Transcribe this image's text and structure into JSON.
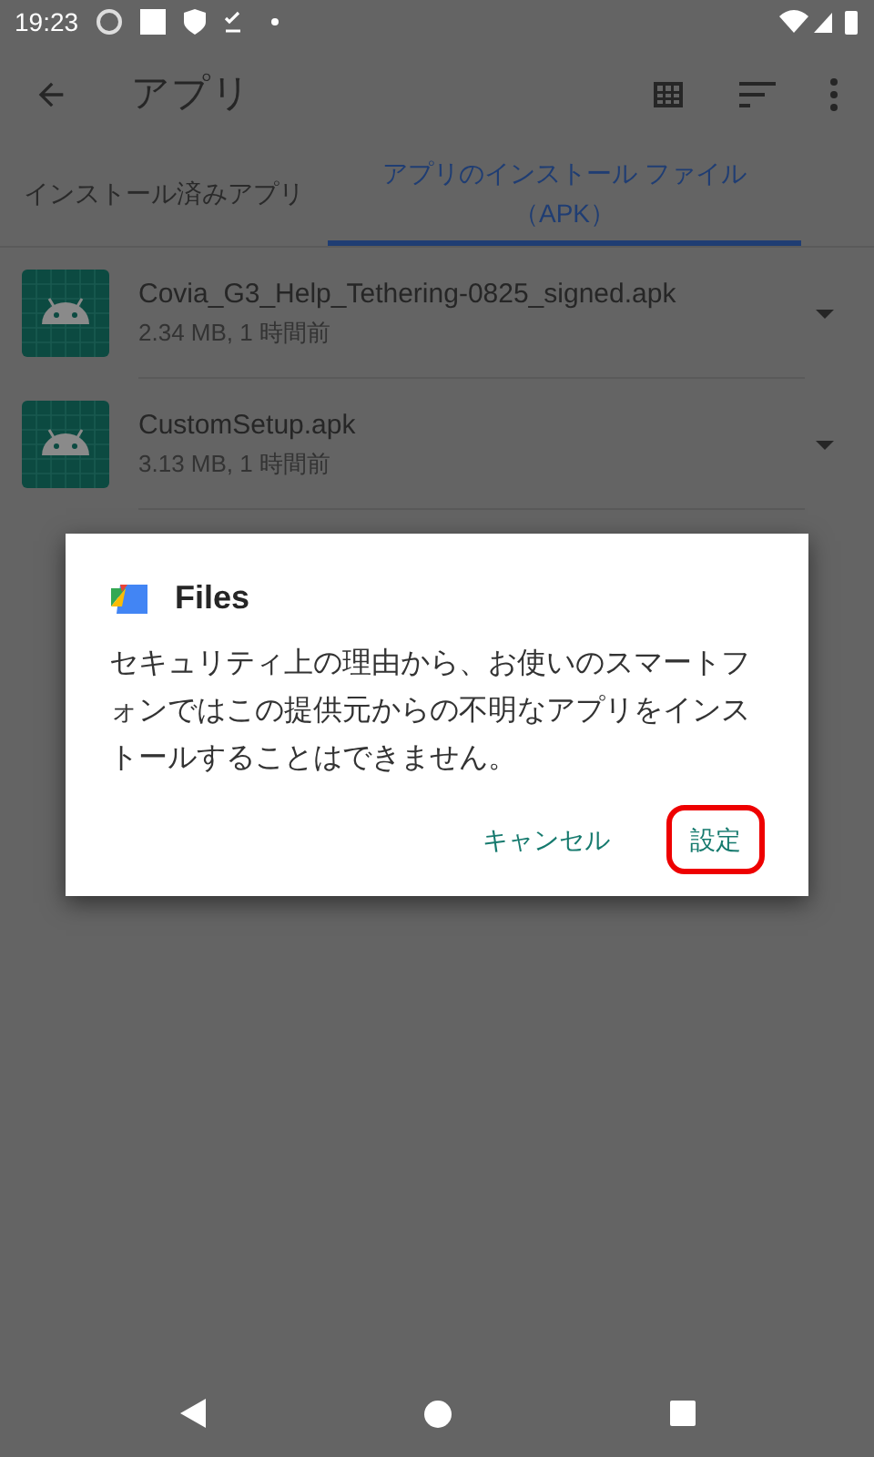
{
  "status_bar": {
    "time": "19:23"
  },
  "toolbar": {
    "title": "アプリ"
  },
  "tabs": [
    {
      "label": "インストール済みアプリ",
      "selected": false
    },
    {
      "label": "アプリのインストール ファイル（APK）",
      "selected": true
    }
  ],
  "files": [
    {
      "name": "Covia_G3_Help_Tethering-0825_signed.apk",
      "details": "2.34 MB, 1 時間前"
    },
    {
      "name": "CustomSetup.apk",
      "details": "3.13 MB, 1 時間前"
    }
  ],
  "dialog": {
    "app": "Files",
    "message": "セキュリティ上の理由から、お使いのスマートフォンではこの提供元からの不明なアプリをインストールすることはできません。",
    "buttons": [
      {
        "label": "キャンセル",
        "highlighted": false
      },
      {
        "label": "設定",
        "highlighted": true
      }
    ]
  }
}
